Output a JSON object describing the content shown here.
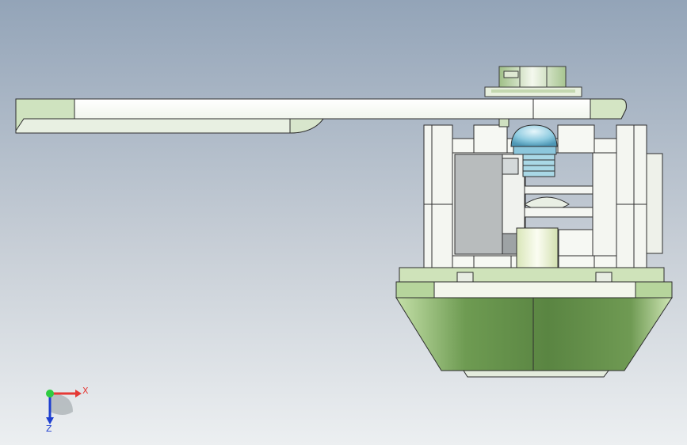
{
  "viewport": {
    "background_top": "#93a4b8",
    "background_bottom": "#eceff1"
  },
  "model": {
    "lever_color": "#f6f8f3",
    "lever_shade": "#c9dcb5",
    "base_color": "#5e8a45",
    "base_shade": "#a7cc8a",
    "frame_color": "#f2f4f0",
    "ball_color": "#9fd4e6",
    "part_gray": "#b8bcbd"
  },
  "triad": {
    "x_label": "X",
    "z_label": "Z",
    "x_color": "#e53935",
    "z_color": "#1e3fd0",
    "origin_color": "#2ecc40"
  }
}
